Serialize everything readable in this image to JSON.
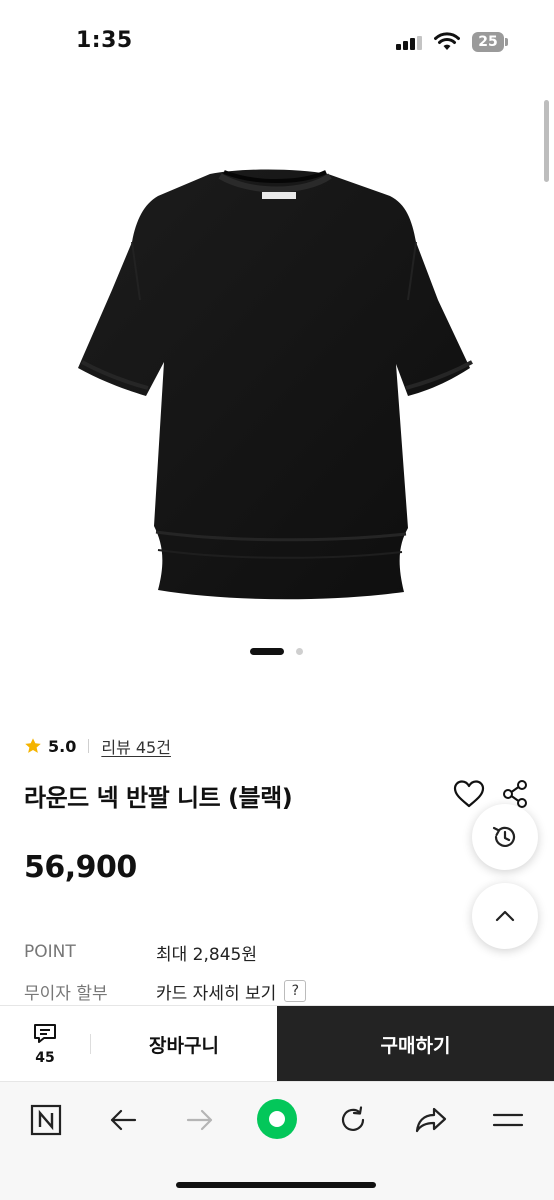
{
  "status_bar": {
    "time": "1:35",
    "battery": "25"
  },
  "product": {
    "rating": "5.0",
    "review_link": "리뷰 45건",
    "title": "라운드 넥 반팔 니트 (블랙)",
    "price": "56,900",
    "image_count": 2,
    "image_index": 1
  },
  "info": {
    "point_label": "POINT",
    "point_value": "최대 2,845원",
    "installment_label": "무이자 할부",
    "installment_value": "카드 자세히 보기",
    "help": "?"
  },
  "purchase_bar": {
    "comment_count": "45",
    "cart_label": "장바구니",
    "buy_label": "구매하기"
  },
  "colors": {
    "accent_green": "#03c75a",
    "star": "#f5b400",
    "buy_button_bg": "#232323"
  },
  "icons": [
    "star-icon",
    "heart-icon",
    "share-icon",
    "history-icon",
    "chevron-up-icon",
    "comment-icon",
    "naver-n-icon",
    "back-arrow-icon",
    "forward-arrow-icon",
    "green-dot-icon",
    "refresh-icon",
    "share-arrow-icon",
    "menu-icon"
  ]
}
